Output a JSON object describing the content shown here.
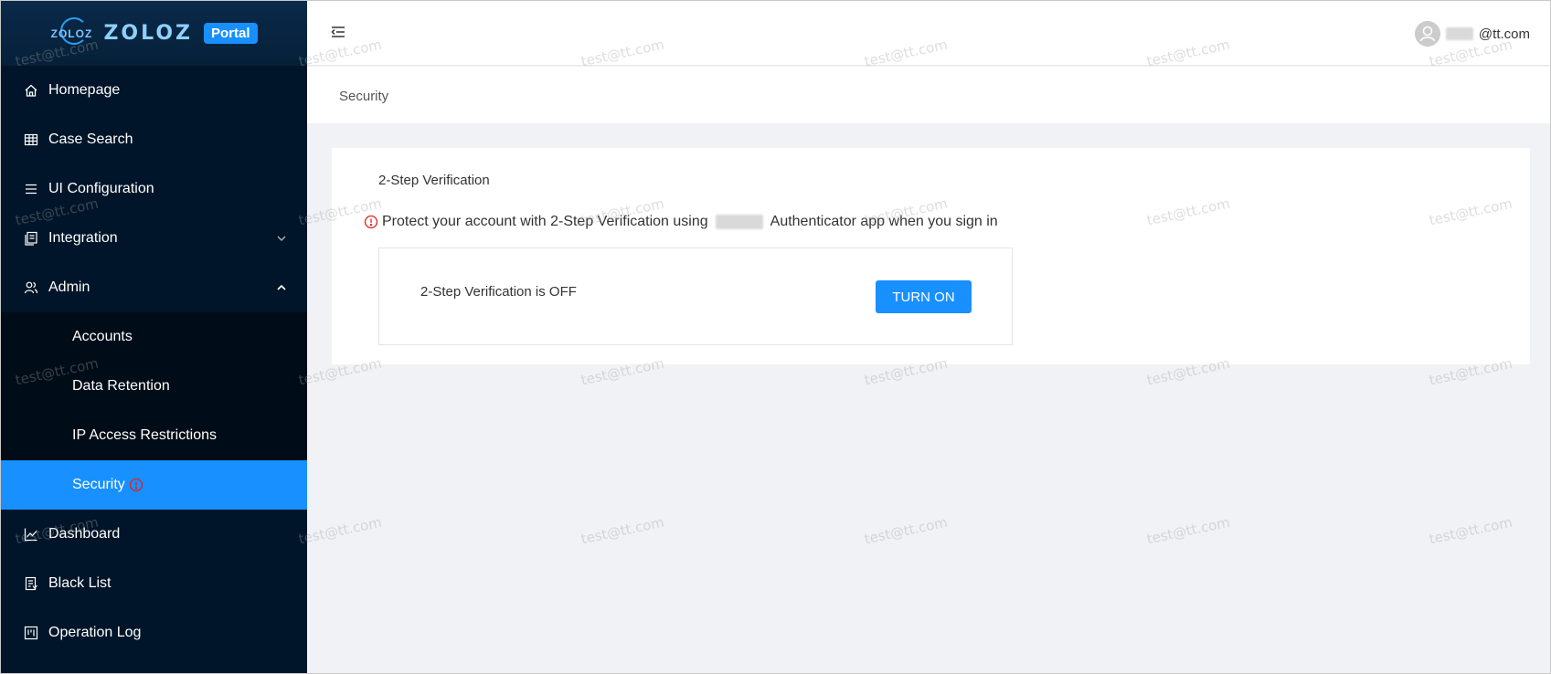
{
  "brand": {
    "logo_mini": "ZOLOZ",
    "logo_text": "ZOLOZ",
    "badge": "Portal"
  },
  "sidebar": {
    "items": [
      {
        "label": "Homepage",
        "icon": "home-icon"
      },
      {
        "label": "Case Search",
        "icon": "table-icon"
      },
      {
        "label": "UI Configuration",
        "icon": "list-icon"
      },
      {
        "label": "Integration",
        "icon": "document-icon",
        "chevron": "down"
      },
      {
        "label": "Admin",
        "icon": "user-group-icon",
        "chevron": "up"
      }
    ],
    "admin_subitems": [
      {
        "label": "Accounts"
      },
      {
        "label": "Data Retention"
      },
      {
        "label": "IP Access Restrictions"
      },
      {
        "label": "Security",
        "active": true
      }
    ],
    "items_after": [
      {
        "label": "Dashboard",
        "icon": "line-chart-icon"
      },
      {
        "label": "Black List",
        "icon": "audit-icon"
      },
      {
        "label": "Operation Log",
        "icon": "project-icon"
      }
    ]
  },
  "header": {
    "user_email_suffix": "@tt.com"
  },
  "breadcrumb": {
    "current": "Security"
  },
  "security_card": {
    "title": "2-Step Verification",
    "desc_before": "Protect your account with 2-Step Verification using",
    "desc_after": "Authenticator app when you sign in",
    "status": "2-Step Verification is OFF",
    "button_label": "TURN ON"
  },
  "watermark": {
    "text": "test@tt.com"
  },
  "colors": {
    "sidebar_bg": "#001529",
    "submenu_bg": "#000c17",
    "accent": "#1890ff",
    "warning": "#e02020",
    "page_bg": "#f0f2f5"
  }
}
